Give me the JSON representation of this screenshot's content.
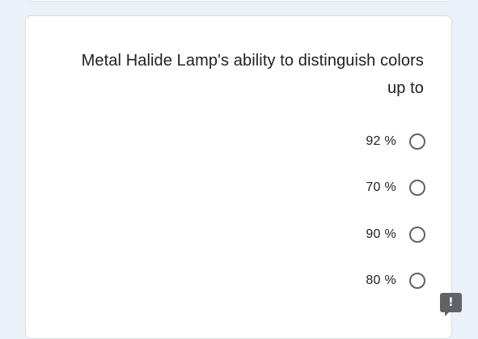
{
  "question": {
    "text": "Metal Halide Lamp's ability to distinguish colors up to"
  },
  "options": [
    {
      "label": "92 %",
      "selected": false
    },
    {
      "label": "70 %",
      "selected": false
    },
    {
      "label": "90 %",
      "selected": false
    },
    {
      "label": "80 %",
      "selected": false
    }
  ],
  "feedback": {
    "icon": "exclamation-icon",
    "glyph": "!"
  },
  "colors": {
    "background": "#eaf1f7",
    "card": "#ffffff",
    "text": "#202124",
    "radio_border": "#5f6368"
  }
}
